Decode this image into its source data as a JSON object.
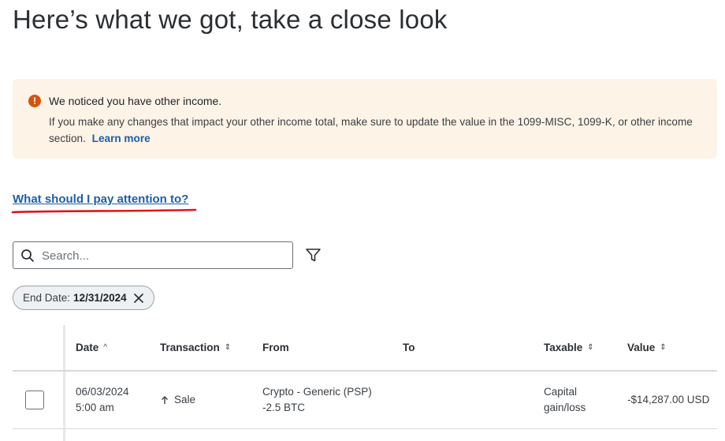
{
  "page": {
    "title": "Here’s what we got, take a close look"
  },
  "alert": {
    "icon": "!",
    "title": "We noticed you have other income.",
    "body": "If you make any changes that impact your other income total, make sure to update the value in the 1099-MISC, 1099-K, or other income section.",
    "link_label": "Learn more",
    "colors": {
      "background": "#fdf3e6",
      "icon": "#d2540f"
    }
  },
  "help_link": {
    "label": "What should I pay attention to?",
    "annotation_color": "#e0141e"
  },
  "search": {
    "placeholder": "Search...",
    "value": ""
  },
  "filter_chip": {
    "label": "End Date:",
    "value": "12/31/2024"
  },
  "table": {
    "columns": [
      {
        "label": "Date",
        "sort": "^"
      },
      {
        "label": "Transaction",
        "sort": "⇕"
      },
      {
        "label": "From",
        "sort": ""
      },
      {
        "label": "To",
        "sort": ""
      },
      {
        "label": "Taxable",
        "sort": "⇕"
      },
      {
        "label": "Value",
        "sort": "⇕"
      }
    ],
    "rows": [
      {
        "date": "06/03/2024",
        "time": "5:00 am",
        "transaction": "Sale",
        "from_name": "Crypto - Generic (PSP)",
        "from_amount": "-2.5 BTC",
        "to": "",
        "taxable_line1": "Capital",
        "taxable_line2": "gain/loss",
        "value": "-$14,287.00 USD"
      }
    ]
  }
}
